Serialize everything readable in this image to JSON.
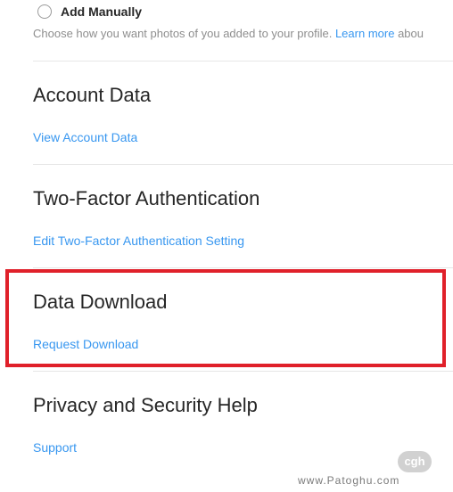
{
  "profile_photo": {
    "option_label": "Add Manually",
    "help_text": "Choose how you want photos of you added to your profile.",
    "learn_more_label": "Learn more",
    "help_text_suffix": "abou"
  },
  "sections": {
    "account_data": {
      "title": "Account Data",
      "link": "View Account Data"
    },
    "two_factor": {
      "title": "Two-Factor Authentication",
      "link": "Edit Two-Factor Authentication Setting"
    },
    "data_download": {
      "title": "Data Download",
      "link": "Request Download"
    },
    "privacy_help": {
      "title": "Privacy and Security Help",
      "link": "Support"
    }
  },
  "watermark": {
    "logo_text": "cgh",
    "site": "www.Patoghu.com"
  },
  "colors": {
    "link": "#3897f0",
    "highlight": "#e0202a",
    "divider": "#e6e6e6",
    "text": "#262626",
    "muted": "#8e8e8e"
  }
}
